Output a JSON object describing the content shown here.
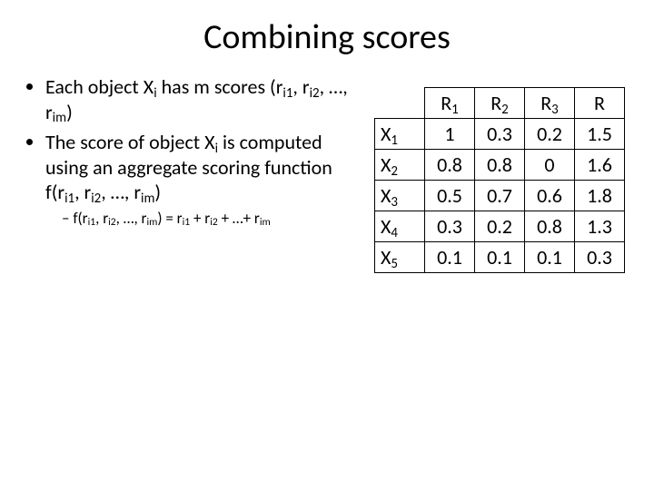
{
  "title": "Combining scores",
  "bullets": {
    "b1_pre": "Each object X",
    "b1_sub": "i",
    "b1_mid": " has m scores (r",
    "b1_s1": "i1",
    "b1_c1": ", r",
    "b1_s2": "i2",
    "b1_c2": ", …, r",
    "b1_s3": "im",
    "b1_post": ")",
    "b2_pre": "The score of object X",
    "b2_sub": "i",
    "b2_mid": " is computed using an aggregate scoring function f(r",
    "b2_s1": "i1",
    "b2_c1": ", r",
    "b2_s2": "i2",
    "b2_c2": ", …, r",
    "b2_s3": "im",
    "b2_post": ")",
    "sub_pre": "f(r",
    "sub_s1": "i1",
    "sub_c1": ", r",
    "sub_s2": "i2",
    "sub_c2": ", …, r",
    "sub_s3": "im",
    "sub_mid": ") = r",
    "sub_s4": "i1",
    "sub_c3": " + r",
    "sub_s5": "i2",
    "sub_c4": " + …+ r",
    "sub_s6": "im"
  },
  "table": {
    "col_R": "R",
    "col_sub": [
      "1",
      "2",
      "3"
    ],
    "col_last": "R",
    "row_X": "X",
    "row_sub": [
      "1",
      "2",
      "3",
      "4",
      "5"
    ],
    "cells": [
      [
        "1",
        "0.3",
        "0.2",
        "1.5"
      ],
      [
        "0.8",
        "0.8",
        "0",
        "1.6"
      ],
      [
        "0.5",
        "0.7",
        "0.6",
        "1.8"
      ],
      [
        "0.3",
        "0.2",
        "0.8",
        "1.3"
      ],
      [
        "0.1",
        "0.1",
        "0.1",
        "0.3"
      ]
    ]
  }
}
